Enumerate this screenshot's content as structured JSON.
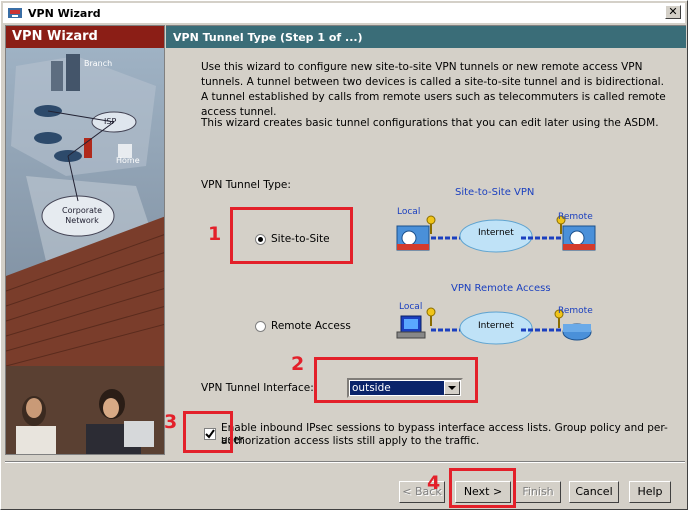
{
  "window": {
    "title": "VPN Wizard",
    "close_glyph": "✕"
  },
  "sidebar": {
    "header": "VPN Wizard",
    "illustration_labels": [
      "Branch",
      "ISP",
      "Home",
      "Corporate Network"
    ]
  },
  "main": {
    "header": "VPN Tunnel Type  (Step 1 of ...)",
    "description": "Use this wizard to configure new site-to-site VPN tunnels or new remote access VPN tunnels. A tunnel between two devices is called a site-to-site tunnel and is bidirectional. A tunnel established by calls from remote users such as telecommuters is called remote access tunnel.",
    "description2": "This wizard creates basic tunnel configurations that you can edit later using the ASDM.",
    "tunnel_type_label": "VPN Tunnel Type:",
    "options": [
      {
        "label": "Site-to-Site",
        "selected": true
      },
      {
        "label": "Remote Access",
        "selected": false
      }
    ],
    "diagram_s2s": {
      "title": "Site-to-Site VPN",
      "local": "Local",
      "internet": "Internet",
      "remote": "Remote"
    },
    "diagram_ra": {
      "title": "VPN Remote Access",
      "local": "Local",
      "internet": "Internet",
      "remote": "Remote"
    },
    "interface_label": "VPN Tunnel Interface:",
    "interface_value": "outside",
    "checkbox": {
      "checked": true,
      "label_line1": "Enable inbound IPsec sessions to bypass interface access lists. Group policy and per-user",
      "label_line2": "authorization access lists still apply to the traffic."
    }
  },
  "annotations": [
    "1",
    "2",
    "3",
    "4"
  ],
  "buttons": {
    "back": "< Back",
    "next": "Next >",
    "finish": "Finish",
    "cancel": "Cancel",
    "help": "Help"
  },
  "colors": {
    "annotation_red": "#e3202a",
    "sidebar_header": "#8b1e16",
    "main_header": "#3a6d78",
    "selection": "#0a246a"
  }
}
